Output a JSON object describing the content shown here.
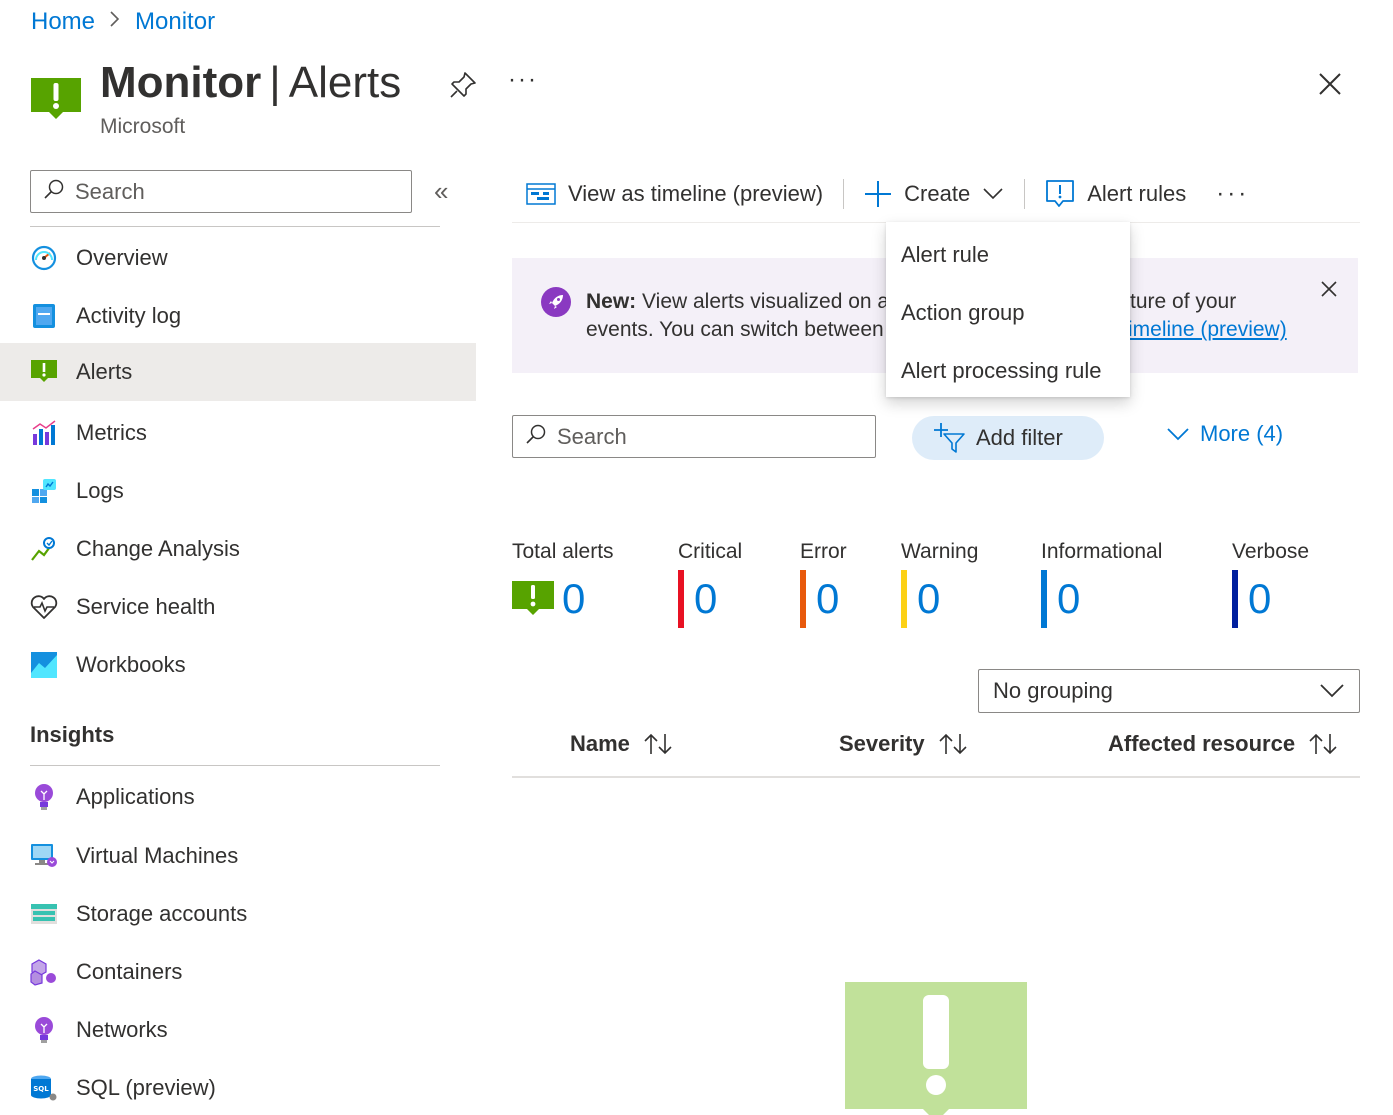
{
  "breadcrumb": {
    "items": [
      "Home",
      "Monitor"
    ]
  },
  "header": {
    "title_bold": "Monitor",
    "title_sep": "|",
    "title_rest": "Alerts",
    "subtitle": "Microsoft",
    "more": "···"
  },
  "sidebar": {
    "search_placeholder": "Search",
    "collapse": "«",
    "items": [
      {
        "label": "Overview",
        "icon": "gauge-icon"
      },
      {
        "label": "Activity log",
        "icon": "log-book-icon"
      },
      {
        "label": "Alerts",
        "icon": "alert-icon"
      },
      {
        "label": "Metrics",
        "icon": "metrics-chart-icon"
      },
      {
        "label": "Logs",
        "icon": "logs-icon"
      },
      {
        "label": "Change Analysis",
        "icon": "change-analysis-icon"
      },
      {
        "label": "Service health",
        "icon": "heart-pulse-icon"
      },
      {
        "label": "Workbooks",
        "icon": "workbook-icon"
      }
    ],
    "insights_title": "Insights",
    "insights": [
      {
        "label": "Applications",
        "icon": "lightbulb-icon"
      },
      {
        "label": "Virtual Machines",
        "icon": "virtual-machine-icon"
      },
      {
        "label": "Storage accounts",
        "icon": "storage-icon"
      },
      {
        "label": "Containers",
        "icon": "containers-icon"
      },
      {
        "label": "Networks",
        "icon": "lightbulb-icon"
      },
      {
        "label": "SQL (preview)",
        "icon": "sql-icon"
      }
    ]
  },
  "toolbar": {
    "timeline": "View as timeline (preview)",
    "create": "Create",
    "alert_rules": "Alert rules",
    "more": "···"
  },
  "create_menu": {
    "items": [
      "Alert rule",
      "Action group",
      "Alert processing rule"
    ]
  },
  "banner": {
    "new_label": "New:",
    "line1_left": "View alerts visualized on a",
    "line2_left": "events. You can switch between",
    "line1_right": "ture of your",
    "link": "imeline (preview)"
  },
  "filters": {
    "search_placeholder": "Search",
    "add_filter": "Add filter",
    "more": "More (4)"
  },
  "summary": [
    {
      "label": "Total alerts",
      "value": "0",
      "color": "#57a300"
    },
    {
      "label": "Critical",
      "value": "0",
      "color": "#e81123"
    },
    {
      "label": "Error",
      "value": "0",
      "color": "#e8590c"
    },
    {
      "label": "Warning",
      "value": "0",
      "color": "#fcd116"
    },
    {
      "label": "Informational",
      "value": "0",
      "color": "#0078d4"
    },
    {
      "label": "Verbose",
      "value": "0",
      "color": "#001f9e"
    }
  ],
  "grouping": {
    "selected": "No grouping"
  },
  "table": {
    "columns": [
      "Name",
      "Severity",
      "Affected resource"
    ]
  },
  "colors": {
    "accent": "#0078d4",
    "alert_green": "#57a300",
    "empty_green": "#c1e19a"
  }
}
